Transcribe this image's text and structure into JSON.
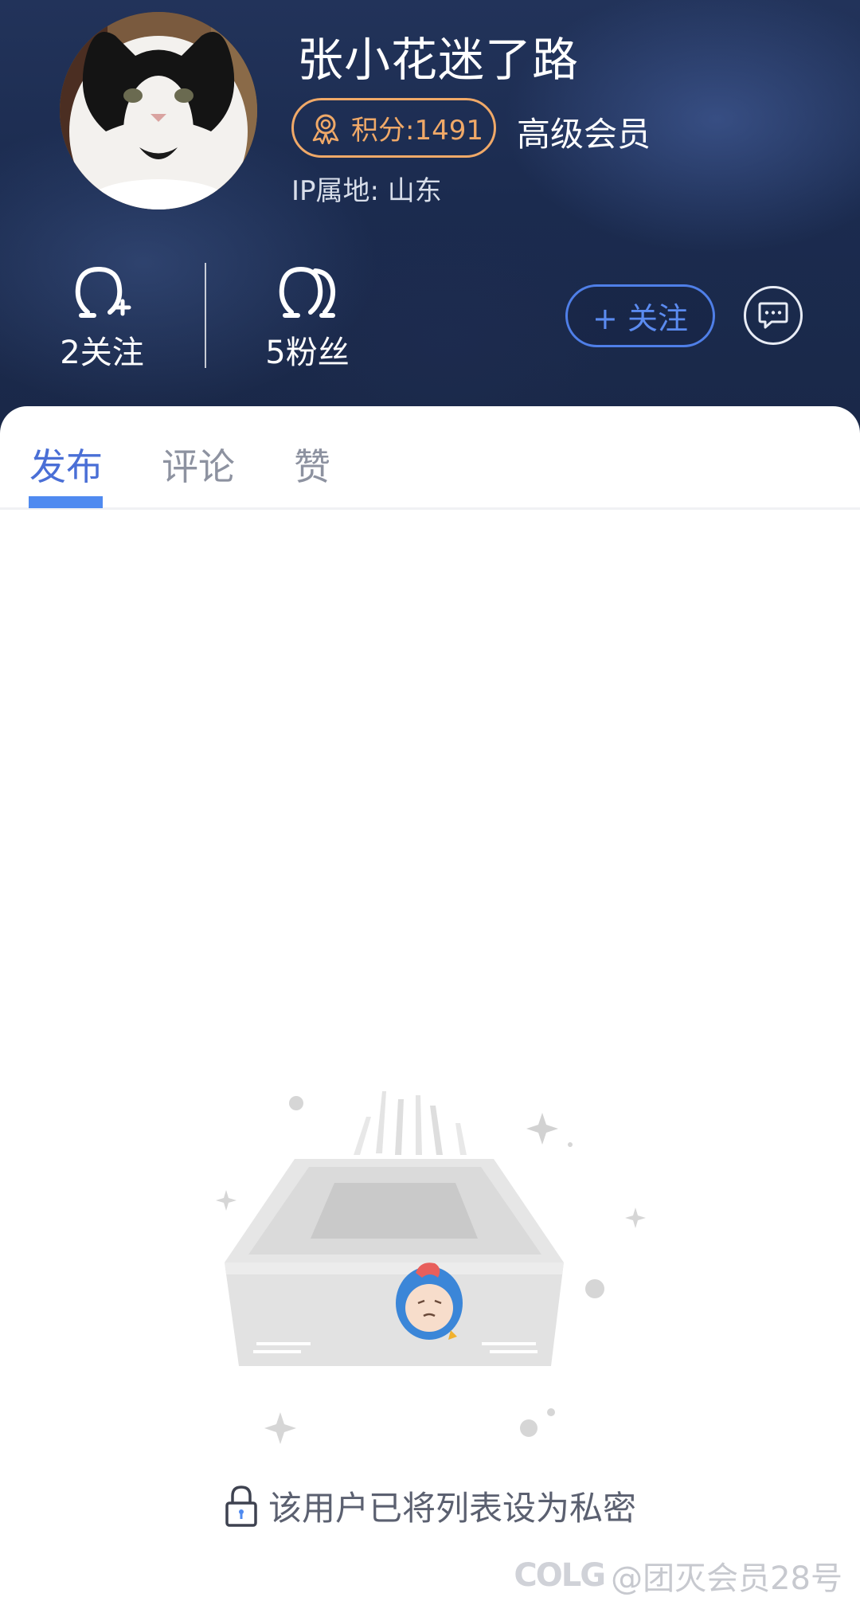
{
  "profile": {
    "username": "张小花迷了路",
    "points_label": "积分:1491",
    "member_level": "高级会员",
    "ip_location": "IP属地: 山东"
  },
  "stats": {
    "following_label": "2关注",
    "fans_label": "5粉丝"
  },
  "actions": {
    "follow_label": "+ 关注"
  },
  "tabs": [
    {
      "label": "发布",
      "active": true
    },
    {
      "label": "评论",
      "active": false
    },
    {
      "label": "赞",
      "active": false
    }
  ],
  "empty_state": {
    "message": "该用户已将列表设为私密"
  },
  "watermark": {
    "logo": "COLG",
    "text": "@团灭会员28号"
  },
  "colors": {
    "accent": "#4f8af0",
    "points": "#f0a968",
    "header_bg": "#1b2b4f"
  },
  "icons": {
    "points": "medal-icon",
    "following": "user-add-icon",
    "fans": "users-icon",
    "message": "chat-bubble-icon",
    "lock": "lock-icon"
  }
}
